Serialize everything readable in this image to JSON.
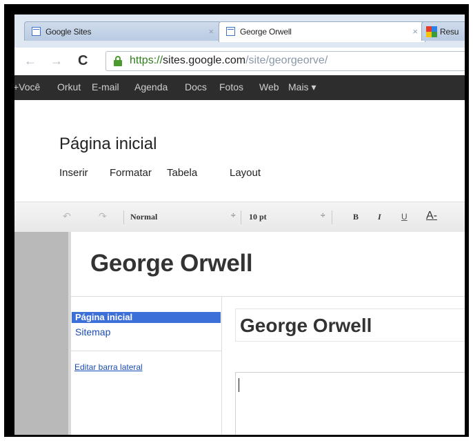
{
  "browser": {
    "tabs": [
      {
        "label": "Google Sites",
        "active": false
      },
      {
        "label": "George Orwell",
        "active": true
      },
      {
        "label": "Resu",
        "active": false
      }
    ],
    "close_glyph": "×",
    "back_glyph": "←",
    "forward_glyph": "→",
    "reload_glyph": "C",
    "url": {
      "scheme": "https://",
      "host": "sites.google.com",
      "path": "/site/georgeorve/"
    }
  },
  "google_bar": {
    "items": [
      "+Você",
      "Orkut",
      "E-mail",
      "Agenda",
      "Docs",
      "Fotos",
      "Web",
      "Mais ▾"
    ]
  },
  "page": {
    "title": "Página inicial",
    "menu": {
      "insert": "Inserir",
      "format": "Formatar",
      "table": "Tabela",
      "layout": "Layout"
    }
  },
  "toolbar": {
    "undo_glyph": "↶",
    "redo_glyph": "↷",
    "style_value": "Normal",
    "size_value": "10 pt",
    "spinner_glyph": "÷",
    "bold": "B",
    "italic": "I",
    "underline": "U",
    "textcolor": "A-"
  },
  "site": {
    "name": "George Orwell",
    "sidebar": {
      "selected": "Página inicial",
      "items": [
        "Sitemap"
      ],
      "edit_link": "Editar barra lateral"
    },
    "page_heading": "George Orwell"
  },
  "colors": {
    "selection": "#3d6fd8",
    "link": "#1a4bb2",
    "url_green": "#2f7d1b",
    "google_bar": "#2d2d2d"
  }
}
